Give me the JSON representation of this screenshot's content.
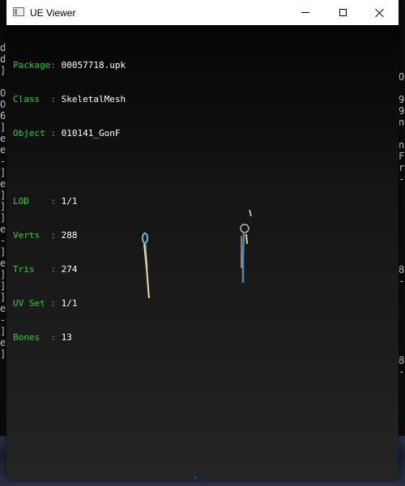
{
  "window": {
    "title": "UE Viewer",
    "controls": {
      "minimize_icon": "minimize-icon",
      "maximize_icon": "maximize-icon",
      "close_icon": "close-icon"
    }
  },
  "info": {
    "header": [
      {
        "label": "Package:",
        "value": "00057718.upk"
      },
      {
        "label": "Class  :",
        "value": "SkeletalMesh"
      },
      {
        "label": "Object :",
        "value": "010141_GonF"
      }
    ],
    "stats": [
      {
        "label": "LOD    :",
        "value": "1/1"
      },
      {
        "label": "Verts  :",
        "value": "288"
      },
      {
        "label": "Tris   :",
        "value": "274"
      },
      {
        "label": "UV Set :",
        "value": "1/1"
      },
      {
        "label": "Bones  :",
        "value": "13"
      }
    ]
  },
  "background_console": {
    "left_text": "d\nd\n]\n\nO\nO\n6\n]\ne\ne\n-\n]\ne\n]\n]\n]\ne\n-\n]\ne\n]\n]\n]\ne\n-\n]\ne\n]",
    "right_text": "O\n\n9\n9\nn\n\nn\nF\nr\n-\n\n\n\n\n\n\n\n8\n-\n\n\n\n\n\n\n8\n-"
  },
  "colors": {
    "label": "#2fd23a",
    "value": "#ffffff",
    "viewport_top": "#050505",
    "viewport_bottom": "#242424"
  }
}
